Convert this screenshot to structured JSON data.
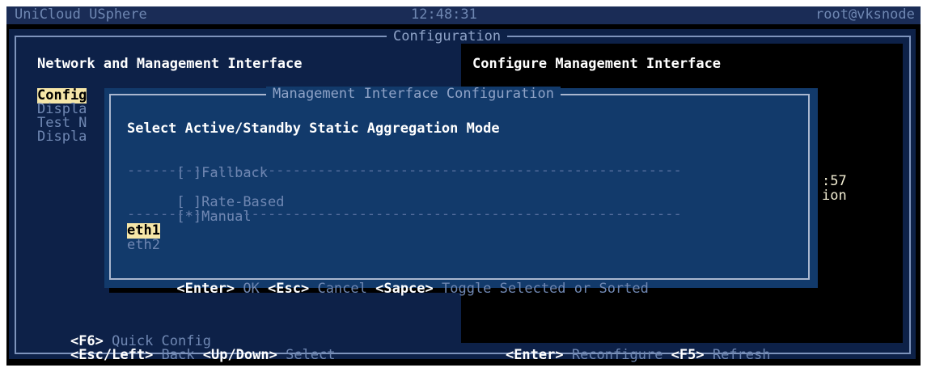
{
  "header": {
    "app_name": "UniCloud USphere",
    "time": "12:48:31",
    "user": "root@vksnode"
  },
  "main_window": {
    "title": "Configuration"
  },
  "left_panel": {
    "title": "Network and Management Interface",
    "menu_items": [
      "Config",
      "Displa",
      "Test N",
      "Displa"
    ],
    "footer_line1_key": "<F6>",
    "footer_line1_text": " Quick Config",
    "footer_line2_key1": "<Esc/Left>",
    "footer_line2_text1": " Back ",
    "footer_line2_key2": "<Up/Down>",
    "footer_line2_text2": " Select"
  },
  "right_panel": {
    "title": "Configure Management Interface",
    "partial_text1": ":57",
    "partial_text2": "ion",
    "footer_key1": "<Enter>",
    "footer_text1": " Reconfigure ",
    "footer_key2": "<F5>",
    "footer_text2": " Refresh"
  },
  "dialog": {
    "title": "Management Interface Configuration",
    "heading": "Select Active/Standby Static Aggregation Mode",
    "options": [
      {
        "mark": "[ ]",
        "label": "Fallback"
      },
      {
        "mark": "[ ]",
        "label": "Rate-Based"
      },
      {
        "mark": "[*]",
        "label": "Manual"
      }
    ],
    "interfaces": [
      "eth1",
      "eth2"
    ],
    "footer": {
      "key1": "<Enter>",
      "text1": " OK ",
      "key2": "<Esc>",
      "text2": " Cancel ",
      "key3": "<Sapce>",
      "text3": " Toggle Selected or Sorted"
    }
  }
}
